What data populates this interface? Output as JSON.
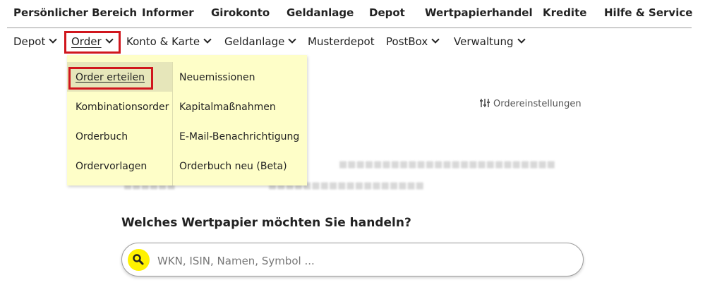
{
  "top_nav": [
    "Persönlicher Bereich",
    "Informer",
    "Girokonto",
    "Geldanlage",
    "Depot",
    "Wertpapierhandel",
    "Kredite",
    "Hilfe & Service"
  ],
  "sub_nav": {
    "depot": "Depot",
    "order": "Order",
    "konto_karte": "Konto & Karte",
    "geldanlage": "Geldanlage",
    "musterdepot": "Musterdepot",
    "postbox": "PostBox",
    "verwaltung": "Verwaltung"
  },
  "order_menu": {
    "left": [
      "Order erteilen",
      "Kombinationsorder",
      "Orderbuch",
      "Ordervorlagen"
    ],
    "right": [
      "Neuemissionen",
      "Kapitalmaßnahmen",
      "E-Mail-Benachrichtigung",
      "Orderbuch neu (Beta)"
    ]
  },
  "page": {
    "settings_label": "Ordereinstellungen",
    "question": "Welches Wertpapier möchten Sie handeln?",
    "search_placeholder": "WKN, ISIN, Namen, Symbol ..."
  },
  "icons": {
    "settings": "sliders-icon",
    "search": "magnifier-icon",
    "chevron": "chevron-down-icon"
  },
  "colors": {
    "menu_bg": "#fefec8",
    "highlight": "#d0161d",
    "search_accent": "#fff200"
  }
}
